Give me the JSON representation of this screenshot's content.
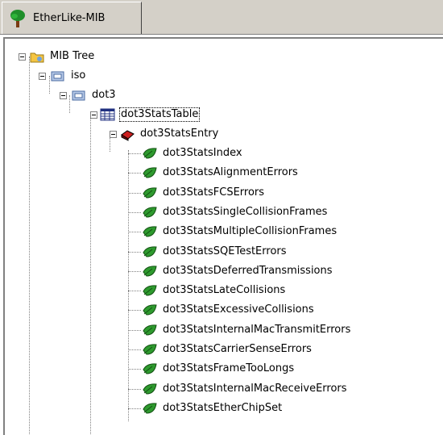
{
  "tab": {
    "label": "EtherLike-MIB",
    "icon": "tree-icon"
  },
  "tree": {
    "root": {
      "label": "MIB Tree",
      "icon": "mib-tree-icon"
    },
    "iso": {
      "label": "iso",
      "icon": "node-folder-icon"
    },
    "dot3": {
      "label": "dot3",
      "icon": "node-folder-icon"
    },
    "table": {
      "label": "dot3StatsTable",
      "icon": "table-icon"
    },
    "entry": {
      "label": "dot3StatsEntry",
      "icon": "entry-icon"
    },
    "leaves": [
      "dot3StatsIndex",
      "dot3StatsAlignmentErrors",
      "dot3StatsFCSErrors",
      "dot3StatsSingleCollisionFrames",
      "dot3StatsMultipleCollisionFrames",
      "dot3StatsSQETestErrors",
      "dot3StatsDeferredTransmissions",
      "dot3StatsLateCollisions",
      "dot3StatsExcessiveCollisions",
      "dot3StatsInternalMacTransmitErrors",
      "dot3StatsCarrierSenseErrors",
      "dot3StatsFrameTooLongs",
      "dot3StatsInternalMacReceiveErrors",
      "dot3StatsEtherChipSet"
    ],
    "leaf_icon": "leaf-icon"
  }
}
